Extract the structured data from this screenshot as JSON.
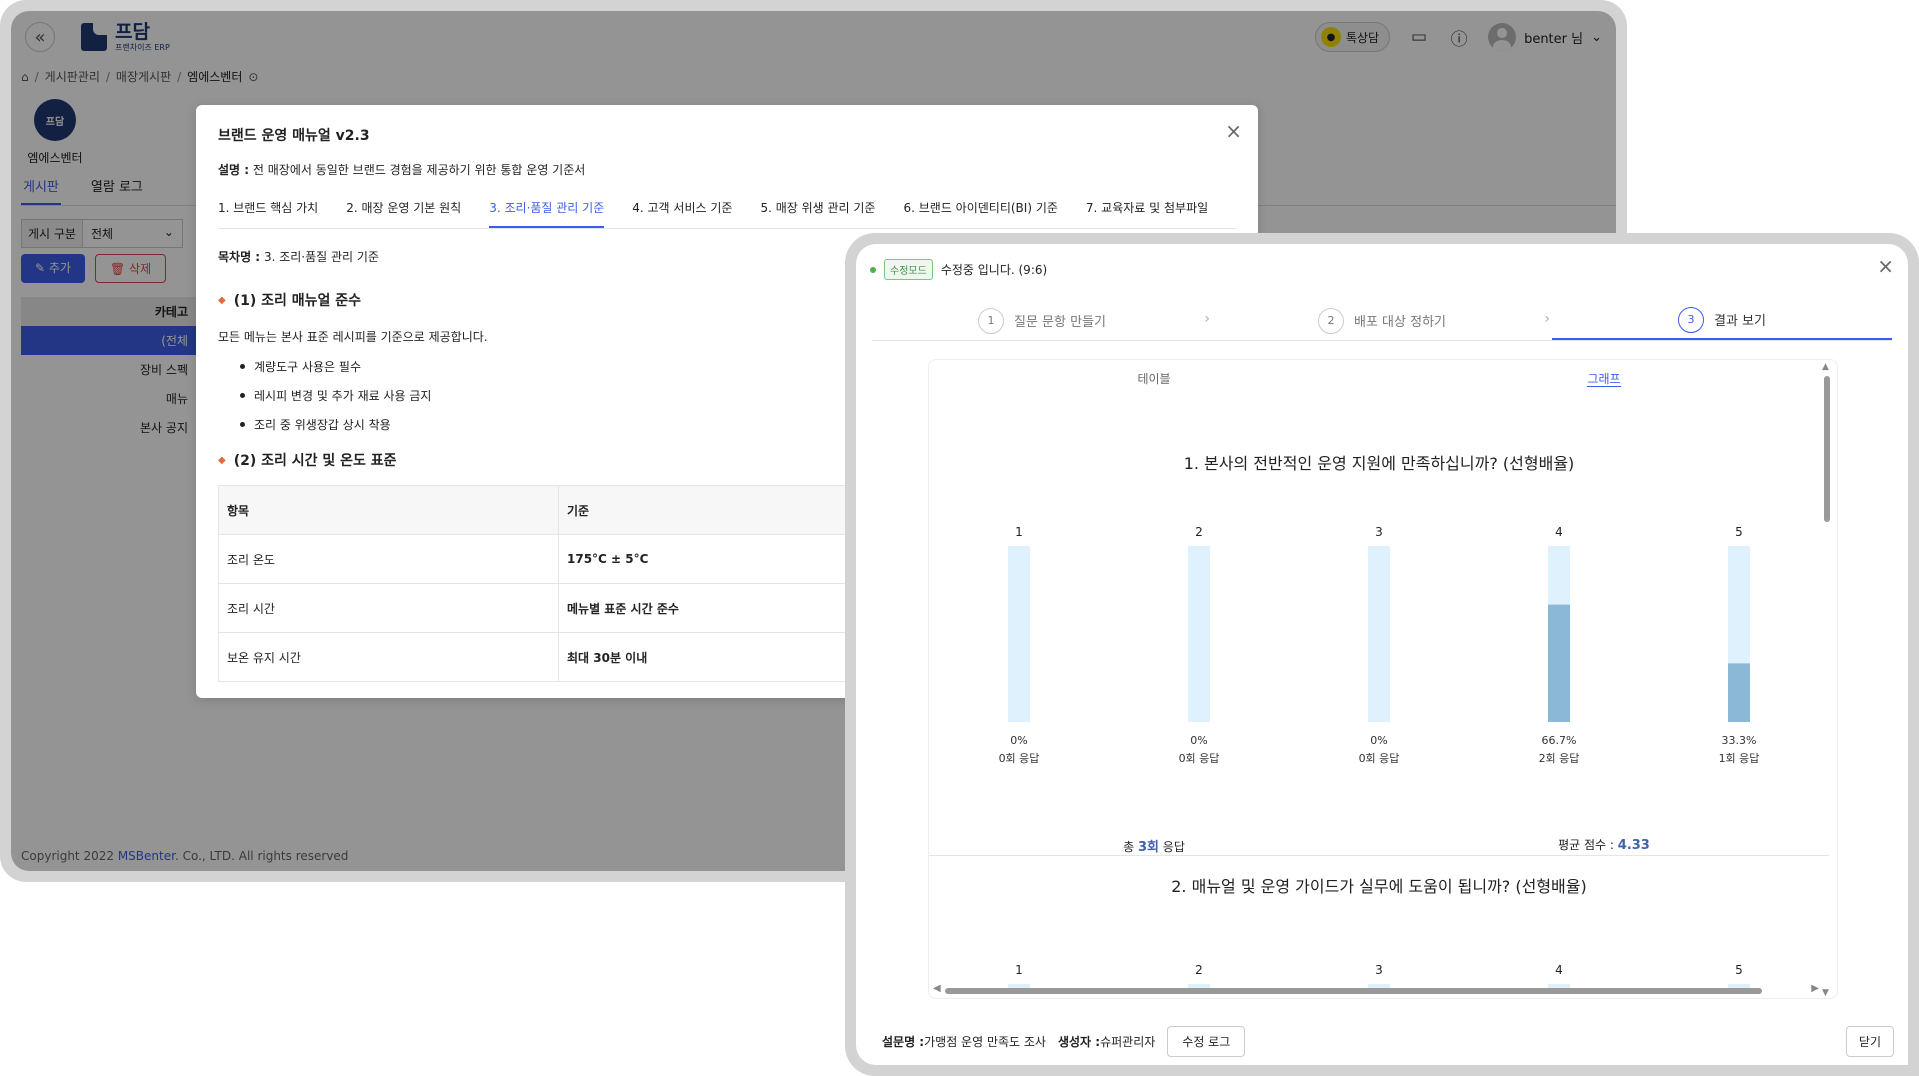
{
  "app": {
    "logo_main": "프담",
    "logo_sub": "프랜차이즈 ERP",
    "collapse": "«",
    "kakao_label": "톡상담",
    "user_name": "benter 님",
    "breadcrumb": [
      "게시판관리",
      "매장게시판",
      "엠에스벤터"
    ],
    "store_name": "엠에스벤터",
    "store_avatar_text": "프담",
    "tabs": [
      "게시판",
      "열람 로그"
    ],
    "filter_label": "게시 구분",
    "filter_value": "전체",
    "add_button": "추가",
    "delete_button": "삭제",
    "category_header": "카테고",
    "categories": [
      "(전체",
      "장비 스펙",
      "매뉴",
      "본사 공지"
    ],
    "copyright_prefix": "Copyright 2022 ",
    "copyright_link": "MSBenter",
    "copyright_suffix": ". Co., LTD. All rights reserved"
  },
  "manual": {
    "title": "브랜드 운영 매뉴얼 v2.3",
    "desc_label": "설명 :",
    "desc_text": "전 매장에서 동일한 브랜드 경험을 제공하기 위한 통합 운영 기준서",
    "tabs": [
      "1. 브랜드 핵심 가치",
      "2. 매장 운영 기본 원칙",
      "3. 조리·품질 관리 기준",
      "4. 고객 서비스 기준",
      "5. 매장 위생 관리 기준",
      "6. 브랜드 아이덴티티(BI) 기준",
      "7. 교육자료 및 첨부파일"
    ],
    "toc_label": "목차명 :",
    "toc_value": "3. 조리·품질 관리 기준",
    "section1": "(1) 조리 매뉴얼 준수",
    "para1": "모든 메뉴는 본사 표준 레시피를 기준으로 제공합니다.",
    "bullets": [
      "계량도구 사용은 필수",
      "레시피 변경 및 추가 재료 사용 금지",
      "조리 중 위생장갑 상시 착용"
    ],
    "section2": "(2) 조리 시간 및 온도 표준",
    "table_headers": [
      "항목",
      "기준"
    ],
    "table_rows": [
      [
        "조리 온도",
        "175°C ± 5°C"
      ],
      [
        "조리 시간",
        "메뉴별 표준 시간 준수"
      ],
      [
        "보온 유지 시간",
        "최대 30분 이내"
      ]
    ]
  },
  "survey": {
    "mode_badge": "수정모드",
    "mode_text": "수정중 입니다. (9:6)",
    "steps": [
      {
        "num": "1",
        "label": "질문 문항 만들기"
      },
      {
        "num": "2",
        "label": "배포 대상 정하기"
      },
      {
        "num": "3",
        "label": "결과 보기"
      }
    ],
    "view_tabs": [
      "테이블",
      "그래프"
    ],
    "q1_title": "1. 본사의 전반적인 운영 지원에 만족하십니까? (선형배율)",
    "total_prefix": "총 ",
    "total_count": "3회",
    "total_suffix": " 응답",
    "avg_label": "평균 점수 : ",
    "avg_value": "4.33",
    "q2_title": "2. 매뉴얼 및 운영 가이드가 실무에 도움이 됩니까? (선형배율)",
    "footer_name_label": "설문명 :",
    "footer_name": "가맹점 운영 만족도 조사",
    "footer_creator_label": "생성자 :",
    "footer_creator": "슈퍼관리자",
    "log_button": "수정 로그",
    "close_button": "닫기",
    "bar_track_color": "#dff1fc",
    "bar_fill_color": "#8bb8d5"
  },
  "chart_data": [
    {
      "type": "bar",
      "title": "1. 본사의 전반적인 운영 지원에 만족하십니까? (선형배율)",
      "categories": [
        "1",
        "2",
        "3",
        "4",
        "5"
      ],
      "values": [
        0,
        0,
        0,
        66.7,
        33.3
      ],
      "percent_labels": [
        "0%",
        "0%",
        "0%",
        "66.7%",
        "33.3%"
      ],
      "count_labels": [
        "0회 응답",
        "0회 응답",
        "0회 응답",
        "2회 응답",
        "1회 응답"
      ],
      "ylim": [
        0,
        100
      ]
    },
    {
      "type": "bar",
      "title": "2. 매뉴얼 및 운영 가이드가 실무에 도움이 됩니까? (선형배율)",
      "categories": [
        "1",
        "2",
        "3",
        "4",
        "5"
      ],
      "values": [],
      "ylim": [
        0,
        100
      ]
    }
  ]
}
